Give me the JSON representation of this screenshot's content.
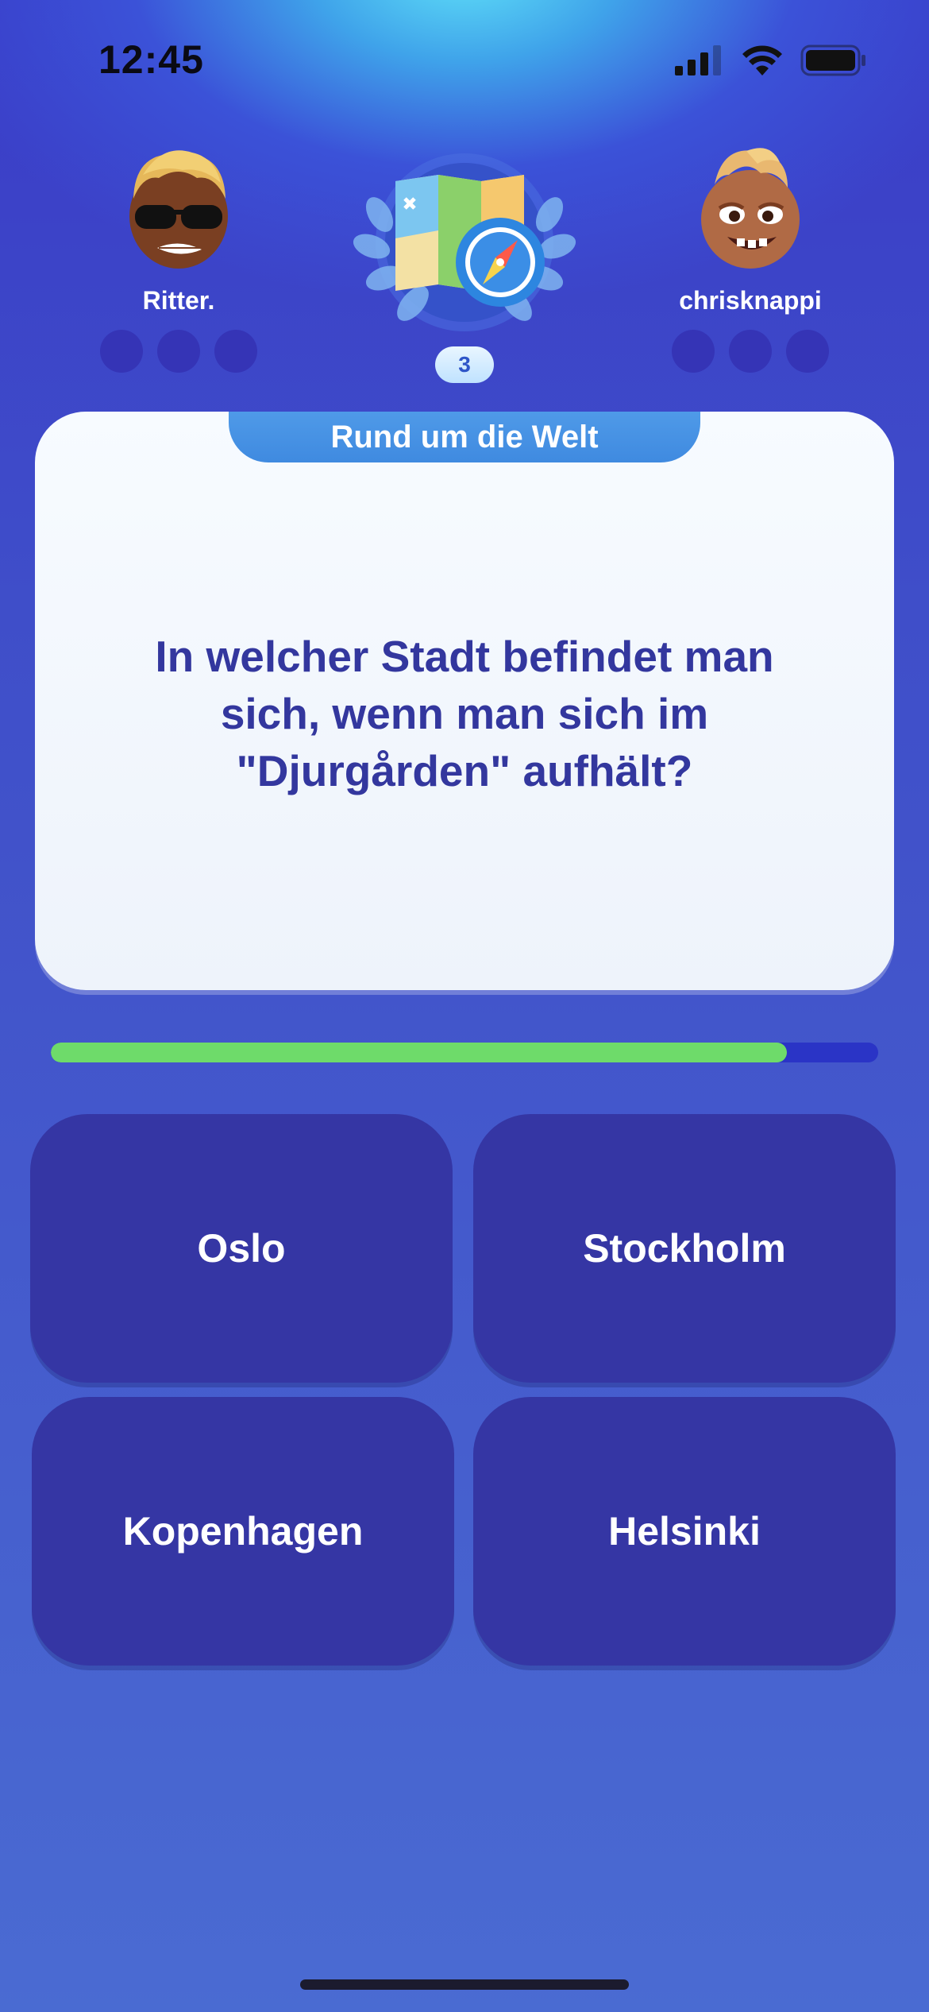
{
  "status_bar": {
    "time": "12:45",
    "icons": [
      "cellular-signal-icon",
      "wifi-icon",
      "battery-icon"
    ]
  },
  "players": {
    "left": {
      "name": "Ritter.",
      "avatar": "avatar-sunglasses",
      "correct_answers": 0
    },
    "right": {
      "name": "chrisknappi",
      "avatar": "avatar-goofy-grin",
      "correct_answers": 0
    }
  },
  "category": {
    "icon": "map-compass-icon",
    "round": "3",
    "name": "Rund um die Welt"
  },
  "question": {
    "text": "In welcher Stadt befindet man sich, wenn man sich im \"Djurgården\" aufhält?"
  },
  "timer": {
    "remaining_fraction": 0.89
  },
  "answers": [
    {
      "label": "Oslo"
    },
    {
      "label": "Stockholm"
    },
    {
      "label": "Kopenhagen"
    },
    {
      "label": "Helsinki"
    }
  ],
  "colors": {
    "card_text": "#33379e",
    "answer_bg": "#3536a4",
    "timer_fill": "#6edb6a",
    "category_tab": "#4f9ae8"
  }
}
